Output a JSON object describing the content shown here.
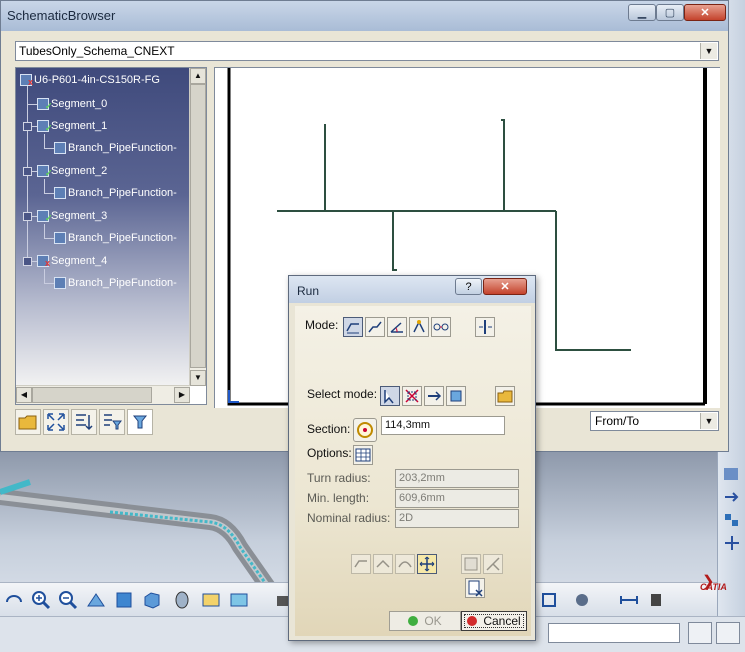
{
  "browser": {
    "title": "SchematicBrowser",
    "window_buttons": {
      "minimize": "▁",
      "maximize": "▢",
      "close": "✕"
    },
    "schema_select": {
      "value": "TubesOnly_Schema_CNEXT",
      "icon": "chevron-down-icon"
    },
    "tree": {
      "root": {
        "label": "U6-P601-4in-CS150R-FG",
        "status": "x"
      },
      "items": [
        {
          "label": "Segment_0",
          "status": "ok"
        },
        {
          "label": "Segment_1",
          "status": "ok"
        },
        {
          "label": "Branch_PipeFunction-",
          "status": "none"
        },
        {
          "label": "Segment_2",
          "status": "ok"
        },
        {
          "label": "Branch_PipeFunction-",
          "status": "none"
        },
        {
          "label": "Segment_3",
          "status": "ok"
        },
        {
          "label": "Branch_PipeFunction-",
          "status": "none"
        },
        {
          "label": "Segment_4",
          "status": "x"
        },
        {
          "label": "Branch_PipeFunction-",
          "status": "none"
        }
      ]
    },
    "toolbar": [
      "open-folder-icon",
      "fit-all-icon",
      "tree-order-icon",
      "tree-filter-icon",
      "filter-icon"
    ],
    "fromto_select": {
      "value": "From/To",
      "icon": "chevron-down-icon"
    }
  },
  "run_dialog": {
    "title": "Run",
    "help_label": "?",
    "close_label": "✕",
    "mode_label": "Mode:",
    "mode_icons": [
      "route-mode-1-icon",
      "route-mode-2-icon",
      "route-angle-icon",
      "route-point-icon",
      "route-offset-icon",
      "route-align-icon"
    ],
    "select_mode_label": "Select mode:",
    "select_mode_icons": [
      "select-point-icon",
      "select-cross-icon",
      "select-path-icon",
      "select-object-icon",
      "open-file-icon"
    ],
    "section_label": "Section:",
    "section_value": "114,3mm",
    "options_label": "Options:",
    "turn_radius_label": "Turn radius:",
    "turn_radius_value": "203,2mm",
    "min_length_label": "Min. length:",
    "min_length_value": "609,6mm",
    "nominal_radius_label": "Nominal radius:",
    "nominal_radius_value": "2D",
    "action_icons": [
      "undo-route-icon",
      "redo-route-icon",
      "smooth-route-icon",
      "move-point-icon",
      "link-icon",
      "branch-icon",
      "clear-icon"
    ],
    "ok_label": "OK",
    "cancel_label": "Cancel"
  },
  "catia": {
    "logo_text": "CATIA"
  },
  "colors": {
    "tree_bg": "#3f4a7c",
    "pipe_line": "#2d4f40",
    "close_red": "#c4432c"
  }
}
